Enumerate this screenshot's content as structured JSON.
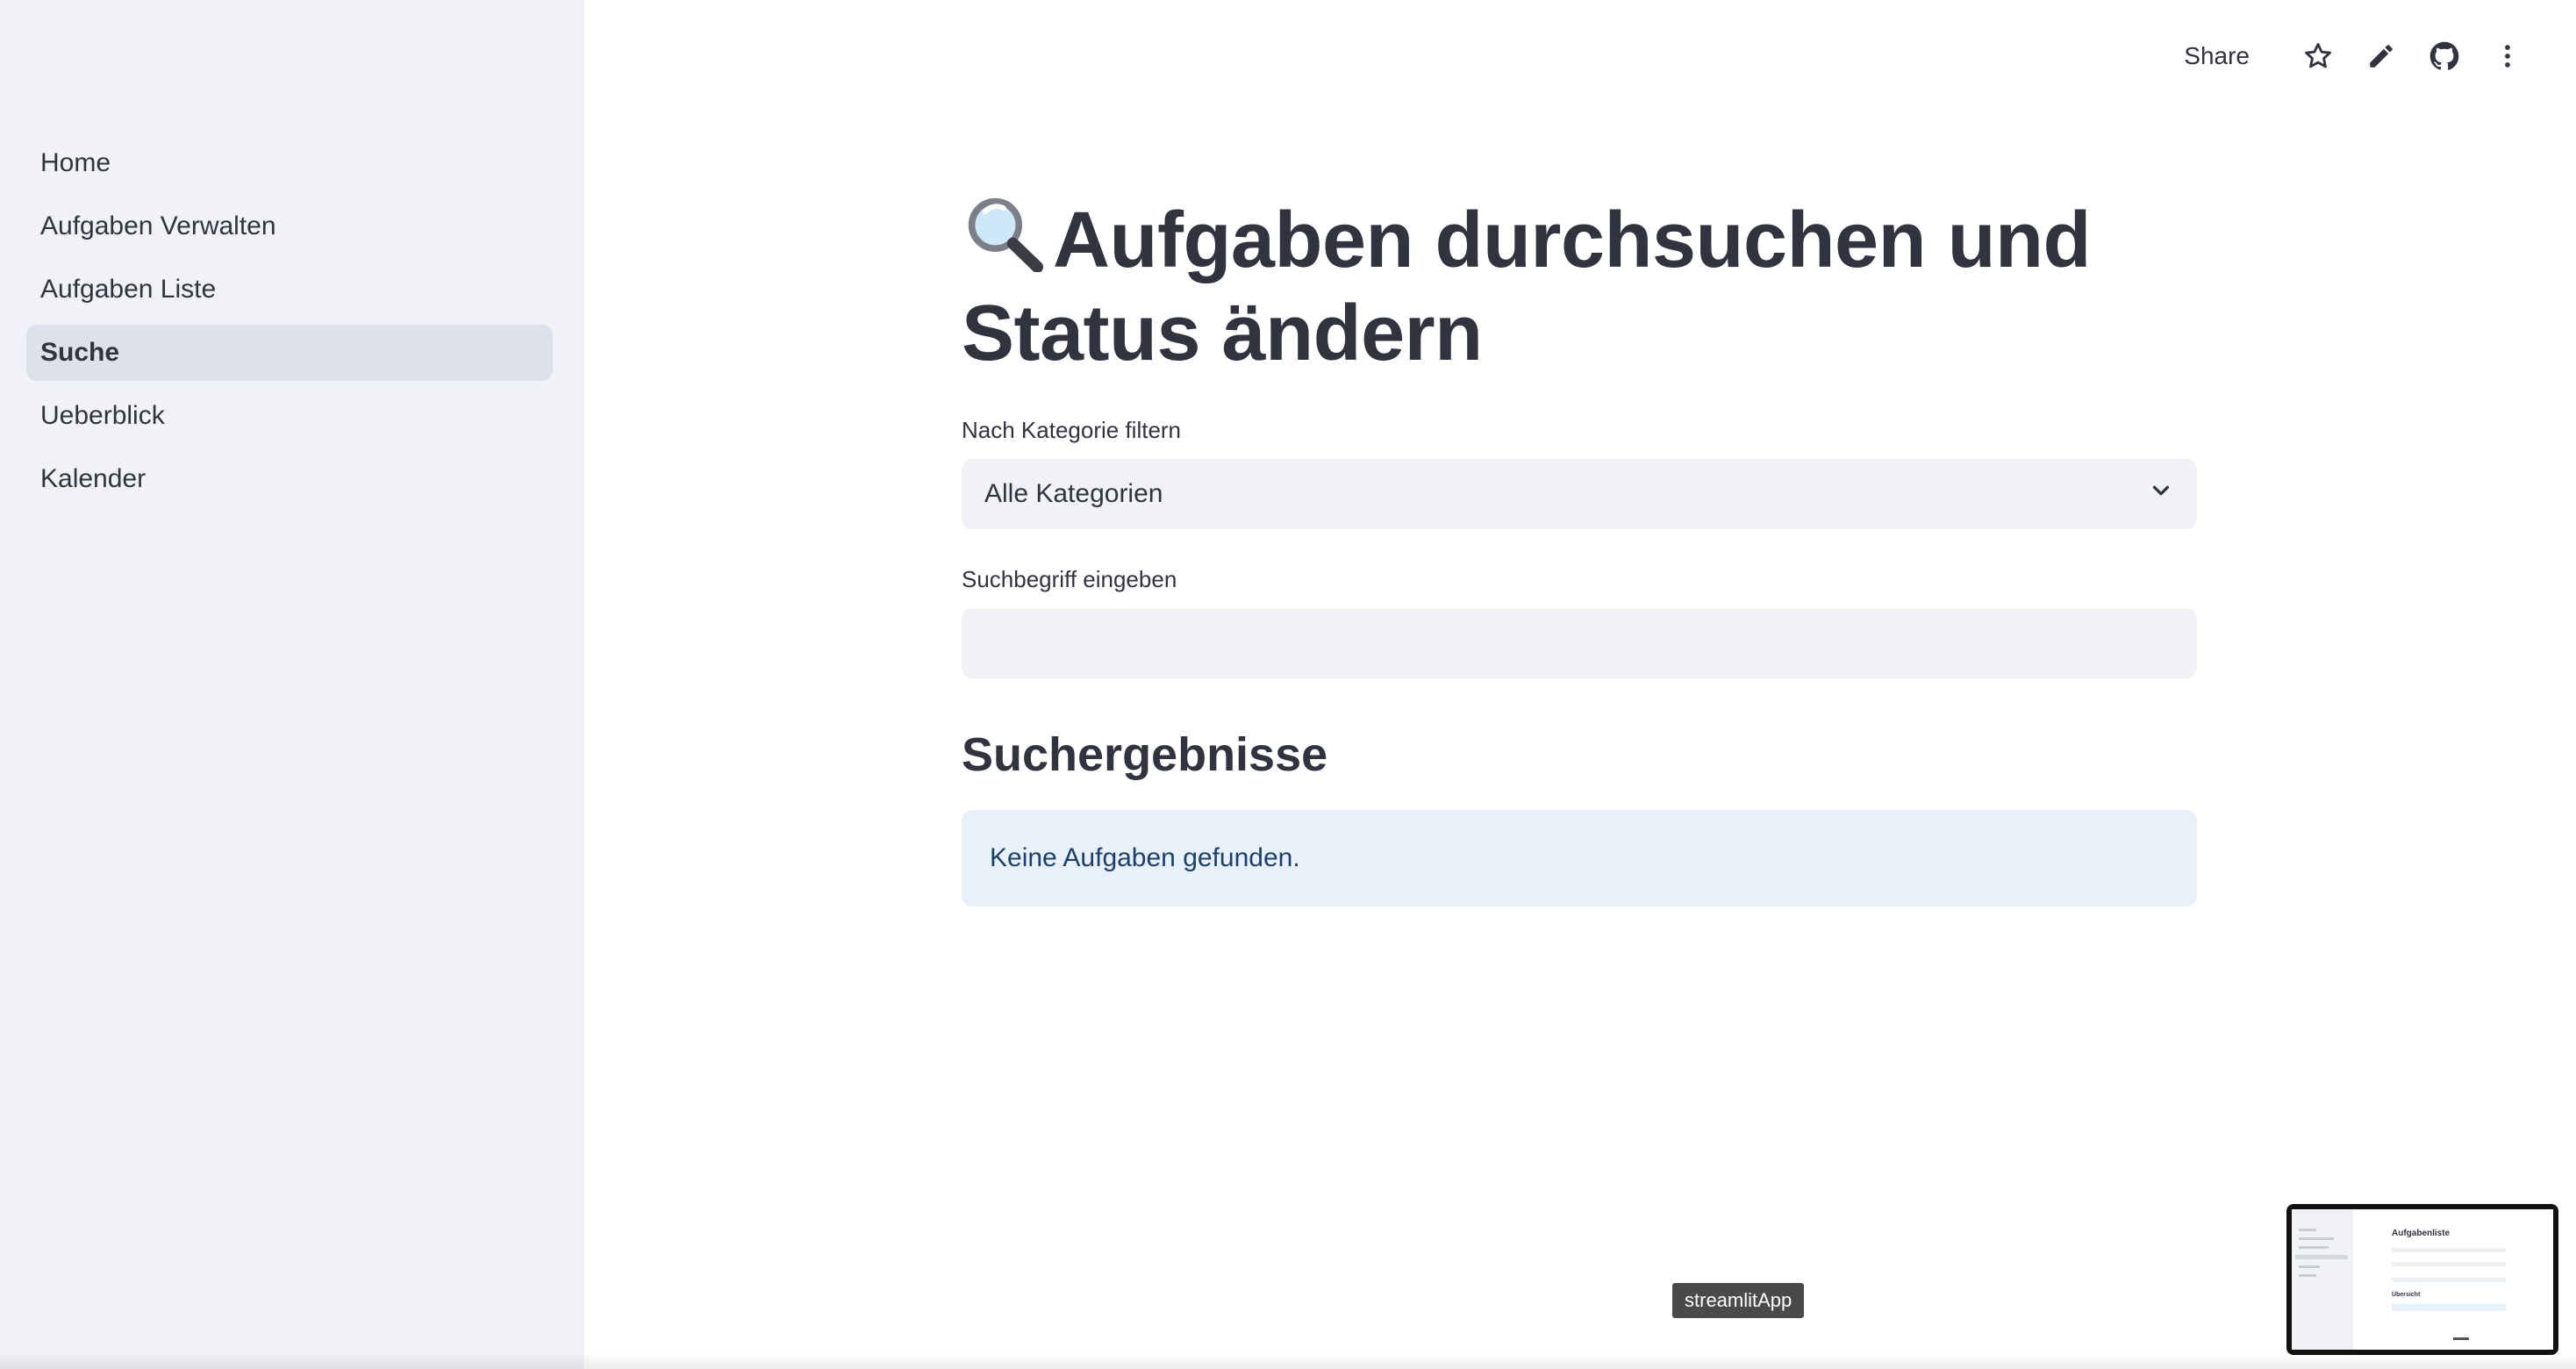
{
  "sidebar": {
    "items": [
      {
        "label": "Home"
      },
      {
        "label": "Aufgaben Verwalten"
      },
      {
        "label": "Aufgaben Liste"
      },
      {
        "label": "Suche",
        "active": true
      },
      {
        "label": "Ueberblick"
      },
      {
        "label": "Kalender"
      }
    ]
  },
  "toolbar": {
    "share_label": "Share",
    "icons": [
      "star-icon",
      "pencil-icon",
      "github-icon",
      "more-vertical-icon"
    ]
  },
  "main": {
    "title": "Aufgaben durchsuchen und Status ändern",
    "title_icon": "magnifier-icon",
    "category_filter": {
      "label": "Nach Kategorie filtern",
      "selected": "Alle Kategorien"
    },
    "search": {
      "label": "Suchbegriff eingeben",
      "value": "",
      "placeholder": ""
    },
    "results_heading": "Suchergebnisse",
    "results_message": "Keine Aufgaben gefunden."
  },
  "tooltip": {
    "text": "streamlitApp"
  },
  "thumbnail": {
    "title": "Aufgabenliste",
    "subtitle": "Übersicht"
  },
  "colors": {
    "sidebar_bg": "#f0f2f6",
    "active_item_bg": "#dde1eb",
    "text": "#31333f",
    "info_bg": "#e8f0fa",
    "info_text": "#1c3f6e"
  }
}
